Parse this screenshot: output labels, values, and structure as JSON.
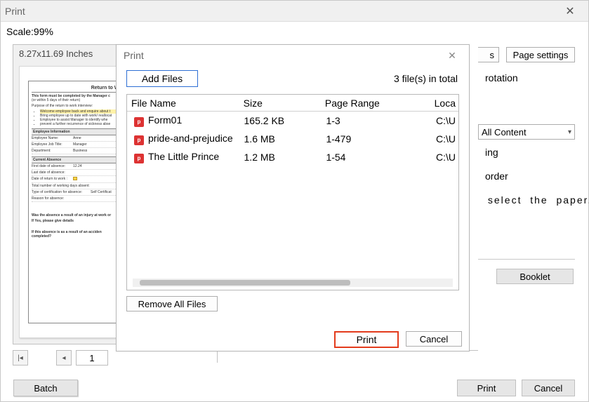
{
  "outer": {
    "title": "Print",
    "scale_label": "Scale:99%",
    "preview_dims": "8.27x11.69 Inches",
    "pager_first_glyph": "|◂",
    "pager_prev_glyph": "◂",
    "pager_value": "1",
    "batch_label": "Batch",
    "print_label": "Print",
    "cancel_label": "Cancel"
  },
  "right": {
    "truncated_button_suffix": "s",
    "page_settings": "Page settings",
    "frag_rotation": "rotation",
    "combo_value": "All Content",
    "frag_ing": "ing",
    "frag_order": " order",
    "frag_select": " select  the  paper...",
    "booklet": "Booklet"
  },
  "inner": {
    "title": "Print",
    "add_files": "Add Files",
    "total_label": "3 file(s) in total",
    "columns": {
      "name": "File Name",
      "size": "Size",
      "range": "Page Range",
      "loc": "Loca"
    },
    "files": [
      {
        "name": "Form01",
        "size": "165.2 KB",
        "range": "1-3",
        "loc": "C:\\U"
      },
      {
        "name": "pride-and-prejudice",
        "size": "1.6 MB",
        "range": "1-479",
        "loc": "C:\\U"
      },
      {
        "name": "The Little Prince",
        "size": "1.2 MB",
        "range": "1-54",
        "loc": "C:\\U"
      }
    ],
    "remove_all": "Remove All Files",
    "print": "Print",
    "cancel": "Cancel"
  },
  "doc": {
    "title": "Return to Work In",
    "sub1": "This form must be completed by the Manager c",
    "sub2": "(or within 5 days of their return)",
    "purpose": "Purpose of the return to work interview:",
    "b1": "Welcome employee back and enquire about t",
    "b2": "Bring employee up to date with work/ reallocat",
    "b3": "Employee to assist Manager to identify whe",
    "b4": "prevent a further recurrence of sickness abse",
    "sec1": "Employee Information",
    "r1l": "Employee Name:",
    "r1v": "Anne",
    "r2l": "Employee Job Title:",
    "r2v": "Manager",
    "r3l": "Department:",
    "r3v": "Business",
    "sec2": "Current Absence",
    "r4l": "First date of absence:",
    "r4v": "12.24",
    "r5l": "Last date of absence:",
    "r6l": "Date of return to work :",
    "r7l": "Total number of working days absent:",
    "r8l": "Type of certification for absence:",
    "r8v": "Self Certificat",
    "r9l": "Reason for absence:",
    "q1": "Was the absence a result of an injury at work or",
    "q2": "If Yes, please give details",
    "q3": "If this absence is as a result of an acciden",
    "q4": "completed?"
  }
}
